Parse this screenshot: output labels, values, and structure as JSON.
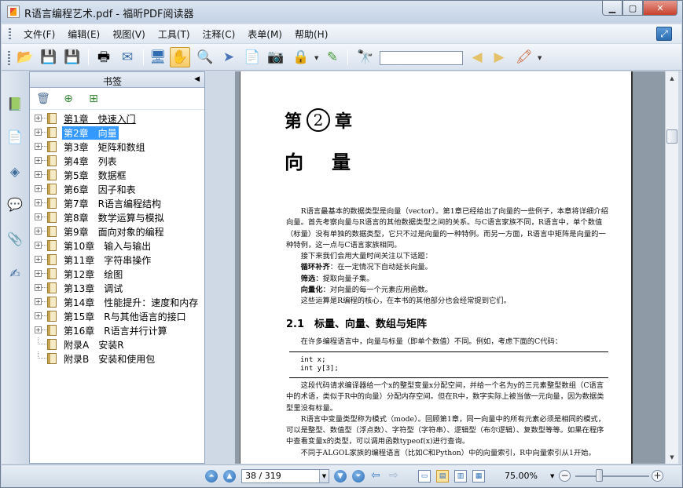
{
  "window": {
    "title": "R语言编程艺术.pdf - 福昕PDF阅读器",
    "controls": [
      "minimize",
      "maximize",
      "close"
    ]
  },
  "menu": {
    "items": [
      "文件(F)",
      "编辑(E)",
      "视图(V)",
      "工具(T)",
      "注释(C)",
      "表单(M)",
      "帮助(H)"
    ]
  },
  "toolbar": {
    "icons": [
      "open-folder-icon",
      "save-icon",
      "save-as-icon",
      "print-icon",
      "email-icon",
      "fullscreen-icon",
      "hand-tool-icon",
      "zoom-loupe-icon",
      "select-arrow-icon",
      "text-select-icon",
      "snapshot-icon",
      "rms-lock-icon",
      "pen-icon",
      "binoculars-icon",
      "search-prev-icon",
      "search-next-icon",
      "highlight-icon"
    ],
    "search_value": ""
  },
  "bookmarks": {
    "title": "书签",
    "items": [
      {
        "label": "第1章　快速入门",
        "expandable": true,
        "state": "current"
      },
      {
        "label": "第2章　向量",
        "expandable": true,
        "state": "selected"
      },
      {
        "label": "第3章　矩阵和数组",
        "expandable": true,
        "state": ""
      },
      {
        "label": "第4章　列表",
        "expandable": true,
        "state": ""
      },
      {
        "label": "第5章　数据框",
        "expandable": true,
        "state": ""
      },
      {
        "label": "第6章　因子和表",
        "expandable": true,
        "state": ""
      },
      {
        "label": "第7章　R语言编程结构",
        "expandable": true,
        "state": ""
      },
      {
        "label": "第8章　数学运算与模拟",
        "expandable": true,
        "state": ""
      },
      {
        "label": "第9章　面向对象的编程",
        "expandable": true,
        "state": ""
      },
      {
        "label": "第10章　输入与输出",
        "expandable": true,
        "state": ""
      },
      {
        "label": "第11章　字符串操作",
        "expandable": true,
        "state": ""
      },
      {
        "label": "第12章　绘图",
        "expandable": true,
        "state": ""
      },
      {
        "label": "第13章　调试",
        "expandable": true,
        "state": ""
      },
      {
        "label": "第14章　性能提升：速度和内存",
        "expandable": true,
        "state": ""
      },
      {
        "label": "第15章　R与其他语言的接口",
        "expandable": true,
        "state": ""
      },
      {
        "label": "第16章　R语言并行计算",
        "expandable": true,
        "state": ""
      },
      {
        "label": "附录A　安装R",
        "expandable": false,
        "state": ""
      },
      {
        "label": "附录B　安装和使用包",
        "expandable": false,
        "state": ""
      }
    ]
  },
  "page": {
    "chapter_prefix": "第",
    "chapter_number": "2",
    "chapter_suffix": "章",
    "chapter_title": "向量",
    "intro": "R语言最基本的数据类型是向量（vector）。第1章已经给出了向量的一些例子，本章将详细介绍向量。首先考察向量与R语言的其他数据类型之间的关系。与C语言家族不同，R语言中，单个数值（标量）没有单独的数据类型，它只不过是向量的一种特例。而另一方面，R语言中矩阵是向量的一种特例，这一点与C语言家族相同。",
    "topics_intro": "接下来我们会用大量时间关注以下话题：",
    "topics": [
      {
        "term": "循环补齐",
        "desc": "：在一定情况下自动延长向量。"
      },
      {
        "term": "筛选",
        "desc": "：提取向量子集。"
      },
      {
        "term": "向量化",
        "desc": "：对向量的每一个元素应用函数。"
      }
    ],
    "topics_outro": "这些运算是R编程的核心，在本书的其他部分也会经常提到它们。",
    "section_title": "2.1　标量、向量、数组与矩阵",
    "section_intro": "在许多编程语言中，向量与标量（即单个数值）不同。例如，考虑下面的C代码：",
    "code_lines": [
      "int x;",
      "int y[3];"
    ],
    "para2": "这段代码请求编译器给一个x的整型变量x分配空间，并给一个名为y的三元素整型数组（C语言中的术语，类似于R中的向量）分配内存空间。但在R中，数字实际上被当做一元向量，因为数据类型里没有标量。",
    "para3": "R语言中变量类型称为模式（mode）。回顾第1章，同一向量中的所有元素必须是相同的模式，可以是整型、数值型（浮点数）、字符型（字符串）、逻辑型（布尔逻辑）、复数型等等。如果在程序中查看变量x的类型，可以调用函数typeof(x)进行查询。",
    "para4": "不同于ALGOL家族的编程语言（比如C和Python）中的向量索引，R中向量索引从1开始。"
  },
  "status": {
    "page_value": "38 / 319",
    "zoom": "75.00%",
    "zoom_level_fraction": 0.3
  }
}
